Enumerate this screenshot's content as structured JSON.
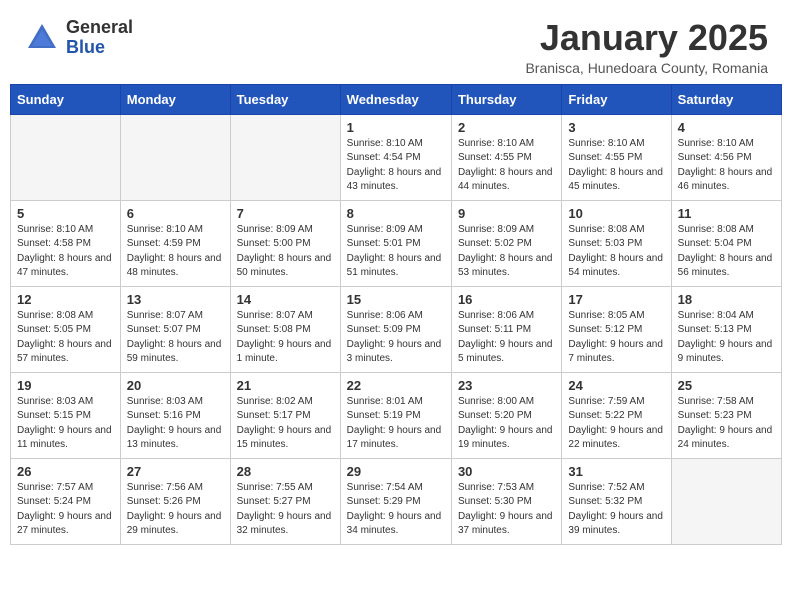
{
  "header": {
    "logo_general": "General",
    "logo_blue": "Blue",
    "month_title": "January 2025",
    "subtitle": "Branisca, Hunedoara County, Romania"
  },
  "days_of_week": [
    "Sunday",
    "Monday",
    "Tuesday",
    "Wednesday",
    "Thursday",
    "Friday",
    "Saturday"
  ],
  "weeks": [
    [
      {
        "day": "",
        "empty": true
      },
      {
        "day": "",
        "empty": true
      },
      {
        "day": "",
        "empty": true
      },
      {
        "day": "1",
        "sunrise": "8:10 AM",
        "sunset": "4:54 PM",
        "daylight": "8 hours and 43 minutes."
      },
      {
        "day": "2",
        "sunrise": "8:10 AM",
        "sunset": "4:55 PM",
        "daylight": "8 hours and 44 minutes."
      },
      {
        "day": "3",
        "sunrise": "8:10 AM",
        "sunset": "4:55 PM",
        "daylight": "8 hours and 45 minutes."
      },
      {
        "day": "4",
        "sunrise": "8:10 AM",
        "sunset": "4:56 PM",
        "daylight": "8 hours and 46 minutes."
      }
    ],
    [
      {
        "day": "5",
        "sunrise": "8:10 AM",
        "sunset": "4:58 PM",
        "daylight": "8 hours and 47 minutes."
      },
      {
        "day": "6",
        "sunrise": "8:10 AM",
        "sunset": "4:59 PM",
        "daylight": "8 hours and 48 minutes."
      },
      {
        "day": "7",
        "sunrise": "8:09 AM",
        "sunset": "5:00 PM",
        "daylight": "8 hours and 50 minutes."
      },
      {
        "day": "8",
        "sunrise": "8:09 AM",
        "sunset": "5:01 PM",
        "daylight": "8 hours and 51 minutes."
      },
      {
        "day": "9",
        "sunrise": "8:09 AM",
        "sunset": "5:02 PM",
        "daylight": "8 hours and 53 minutes."
      },
      {
        "day": "10",
        "sunrise": "8:08 AM",
        "sunset": "5:03 PM",
        "daylight": "8 hours and 54 minutes."
      },
      {
        "day": "11",
        "sunrise": "8:08 AM",
        "sunset": "5:04 PM",
        "daylight": "8 hours and 56 minutes."
      }
    ],
    [
      {
        "day": "12",
        "sunrise": "8:08 AM",
        "sunset": "5:05 PM",
        "daylight": "8 hours and 57 minutes."
      },
      {
        "day": "13",
        "sunrise": "8:07 AM",
        "sunset": "5:07 PM",
        "daylight": "8 hours and 59 minutes."
      },
      {
        "day": "14",
        "sunrise": "8:07 AM",
        "sunset": "5:08 PM",
        "daylight": "9 hours and 1 minute."
      },
      {
        "day": "15",
        "sunrise": "8:06 AM",
        "sunset": "5:09 PM",
        "daylight": "9 hours and 3 minutes."
      },
      {
        "day": "16",
        "sunrise": "8:06 AM",
        "sunset": "5:11 PM",
        "daylight": "9 hours and 5 minutes."
      },
      {
        "day": "17",
        "sunrise": "8:05 AM",
        "sunset": "5:12 PM",
        "daylight": "9 hours and 7 minutes."
      },
      {
        "day": "18",
        "sunrise": "8:04 AM",
        "sunset": "5:13 PM",
        "daylight": "9 hours and 9 minutes."
      }
    ],
    [
      {
        "day": "19",
        "sunrise": "8:03 AM",
        "sunset": "5:15 PM",
        "daylight": "9 hours and 11 minutes."
      },
      {
        "day": "20",
        "sunrise": "8:03 AM",
        "sunset": "5:16 PM",
        "daylight": "9 hours and 13 minutes."
      },
      {
        "day": "21",
        "sunrise": "8:02 AM",
        "sunset": "5:17 PM",
        "daylight": "9 hours and 15 minutes."
      },
      {
        "day": "22",
        "sunrise": "8:01 AM",
        "sunset": "5:19 PM",
        "daylight": "9 hours and 17 minutes."
      },
      {
        "day": "23",
        "sunrise": "8:00 AM",
        "sunset": "5:20 PM",
        "daylight": "9 hours and 19 minutes."
      },
      {
        "day": "24",
        "sunrise": "7:59 AM",
        "sunset": "5:22 PM",
        "daylight": "9 hours and 22 minutes."
      },
      {
        "day": "25",
        "sunrise": "7:58 AM",
        "sunset": "5:23 PM",
        "daylight": "9 hours and 24 minutes."
      }
    ],
    [
      {
        "day": "26",
        "sunrise": "7:57 AM",
        "sunset": "5:24 PM",
        "daylight": "9 hours and 27 minutes."
      },
      {
        "day": "27",
        "sunrise": "7:56 AM",
        "sunset": "5:26 PM",
        "daylight": "9 hours and 29 minutes."
      },
      {
        "day": "28",
        "sunrise": "7:55 AM",
        "sunset": "5:27 PM",
        "daylight": "9 hours and 32 minutes."
      },
      {
        "day": "29",
        "sunrise": "7:54 AM",
        "sunset": "5:29 PM",
        "daylight": "9 hours and 34 minutes."
      },
      {
        "day": "30",
        "sunrise": "7:53 AM",
        "sunset": "5:30 PM",
        "daylight": "9 hours and 37 minutes."
      },
      {
        "day": "31",
        "sunrise": "7:52 AM",
        "sunset": "5:32 PM",
        "daylight": "9 hours and 39 minutes."
      },
      {
        "day": "",
        "empty": true
      }
    ]
  ]
}
